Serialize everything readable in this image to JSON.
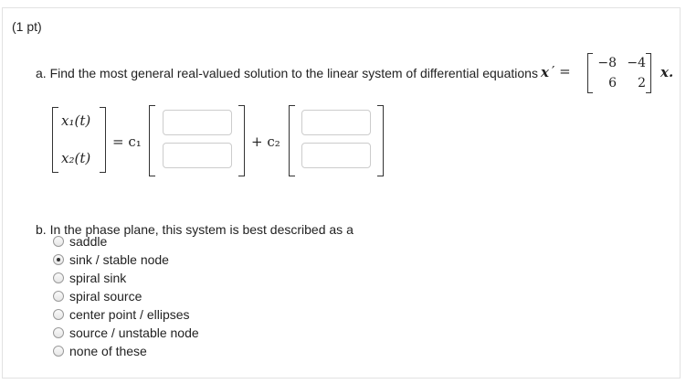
{
  "problem": {
    "points": "(1 pt)",
    "part_a": {
      "prompt": "a. Find the most general real-valued solution to the linear system of differential equations",
      "lhs_symbol": "x",
      "prime_eq": "′ =",
      "matrix": [
        [
          "−8",
          "−4"
        ],
        [
          "6",
          "2"
        ]
      ],
      "rhs_symbol": "x.",
      "solution_lhs": [
        "x₁(t)",
        "x₂(t)"
      ],
      "eq_c1": "= c₁",
      "plus_c2": "+ c₂",
      "answer_fields": [
        {
          "value": ""
        },
        {
          "value": ""
        },
        {
          "value": ""
        },
        {
          "value": ""
        }
      ]
    },
    "part_b": {
      "prompt": "b. In the phase plane, this system is best described as a",
      "options": [
        {
          "label": "saddle",
          "selected": false
        },
        {
          "label": "sink / stable node",
          "selected": true
        },
        {
          "label": "spiral sink",
          "selected": false
        },
        {
          "label": "spiral source",
          "selected": false
        },
        {
          "label": "center point / ellipses",
          "selected": false
        },
        {
          "label": "source / unstable node",
          "selected": false
        },
        {
          "label": "none of these",
          "selected": false
        }
      ]
    }
  }
}
